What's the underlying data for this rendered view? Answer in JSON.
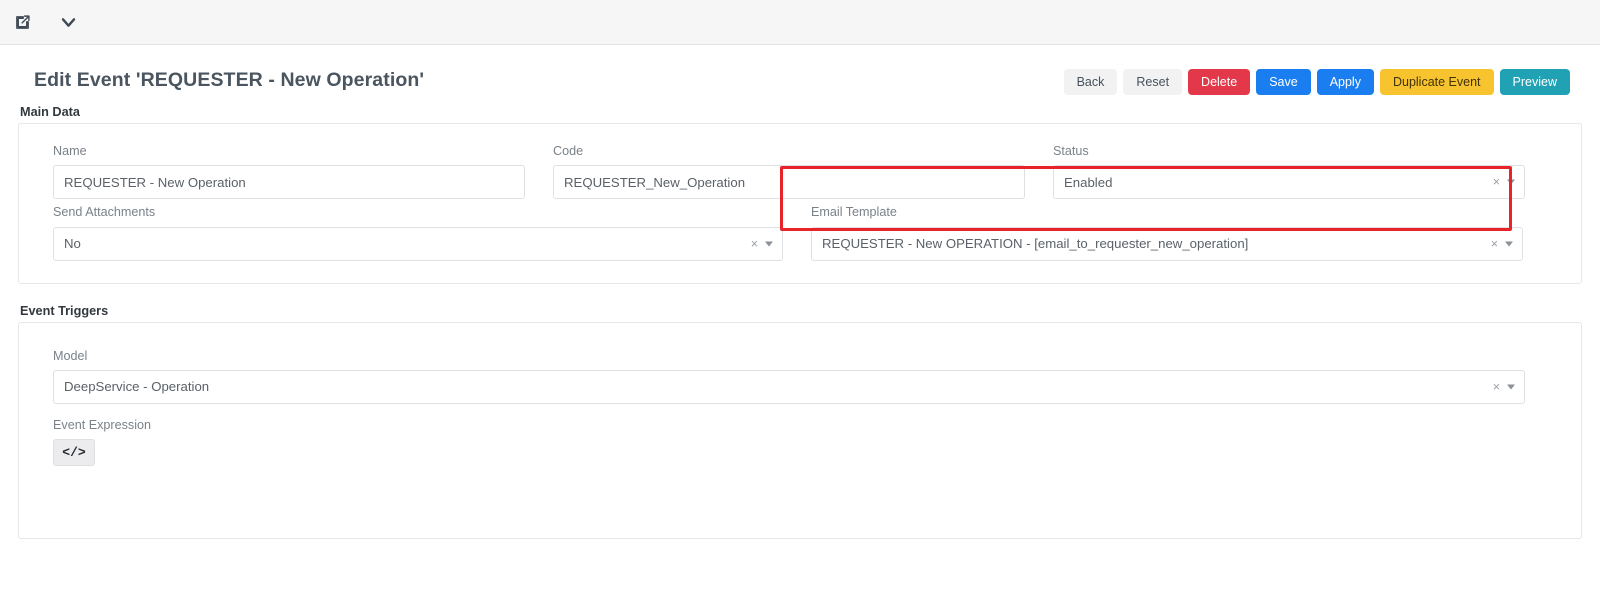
{
  "toolbar": {
    "edit_icon": "edit-square-icon",
    "chevron_icon": "chevron-down-icon"
  },
  "header": {
    "title": "Edit Event 'REQUESTER - New Operation'",
    "buttons": [
      {
        "label": "Back",
        "style": "light"
      },
      {
        "label": "Reset",
        "style": "light"
      },
      {
        "label": "Delete",
        "style": "danger"
      },
      {
        "label": "Save",
        "style": "primary"
      },
      {
        "label": "Apply",
        "style": "primary"
      },
      {
        "label": "Duplicate Event",
        "style": "warning"
      },
      {
        "label": "Preview",
        "style": "teal"
      }
    ]
  },
  "main_data": {
    "section_label": "Main Data",
    "name": {
      "label": "Name",
      "value": "REQUESTER - New Operation",
      "placeholder": ""
    },
    "code": {
      "label": "Code",
      "value": "REQUESTER_New_Operation",
      "placeholder": ""
    },
    "status": {
      "label": "Status",
      "value": "Enabled",
      "clear": "×"
    },
    "send_attachments": {
      "label": "Send Attachments",
      "value": "No",
      "clear": "×"
    },
    "email_template": {
      "label": "Email Template",
      "value": "REQUESTER - New OPERATION - [email_to_requester_new_operation]",
      "clear": "×",
      "highlight_color": "#e8232a"
    }
  },
  "event_triggers": {
    "section_label": "Event Triggers",
    "model": {
      "label": "Model",
      "value": "DeepService - Operation",
      "clear": "×"
    },
    "event_expression": {
      "label": "Event Expression",
      "code_button_glyph": "</>"
    }
  },
  "colors": {
    "danger": "#e2384a",
    "primary": "#1a7ef0",
    "warning": "#f7c32e",
    "teal": "#21a2b4",
    "light": "#f2f2f3",
    "annotation": "#e8232a"
  }
}
